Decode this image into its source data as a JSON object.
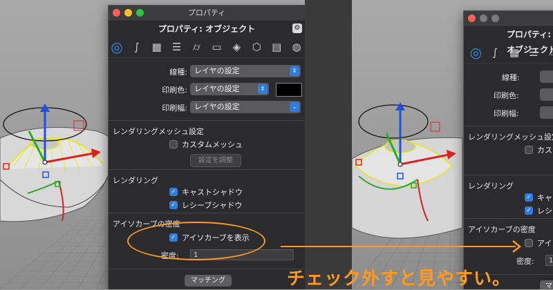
{
  "window": {
    "title": "プロパティ",
    "subtitle": "プロパティ: オブジェクト"
  },
  "toolbar": {
    "icons": [
      "object-props-icon",
      "curve-icon",
      "material-icon",
      "layers-icon",
      "cylinder-icon",
      "page-icon",
      "texture-icon",
      "box-icon",
      "surface-icon",
      "sphere-icon"
    ]
  },
  "props": {
    "linetype_label": "線種:",
    "linetype_value": "レイヤの設定",
    "print_color_label": "印刷色:",
    "print_color_value": "レイヤの設定",
    "print_color_swatch": "#000000",
    "print_width_label": "印刷幅:",
    "print_width_value": "レイヤの設定"
  },
  "render_mesh": {
    "heading": "レンダリングメッシュ設定",
    "custom_mesh_label": "カスタムメッシュ",
    "custom_mesh_checked": false,
    "adjust_button": "設定を調整"
  },
  "rendering": {
    "heading": "レンダリング",
    "cast_shadows_label": "キャストシャドウ",
    "cast_shadows_checked": true,
    "receive_shadows_label": "レシーブシャドウ",
    "receive_shadows_checked": true
  },
  "isocurve": {
    "heading": "アイソカーブの密度",
    "show_label": "アイソカーブを表示",
    "show_checked_before": true,
    "show_checked_after": false,
    "density_label": "密度:",
    "density_value": "1"
  },
  "matching_button": "マッチング",
  "right_panel": {
    "linetype_label": "線種:",
    "print_color_label": "印刷色:",
    "print_width_label": "印刷幅:",
    "mesh_heading_partial": "レンダリングメッシュ設定",
    "custom_mesh_partial": "カスタ",
    "rendering_heading": "レンダリング",
    "cast_partial": "キャス",
    "receive_partial": "レシー",
    "isocurve_heading": "アイソカーブの密度",
    "isocurve_partial": "アイソ",
    "density_label": "密度:",
    "density_partial": "1",
    "matching_partial": "マ"
  },
  "annotation": {
    "text": "チェック外すと見やすい。",
    "color": "#ff9a1f"
  },
  "colors": {
    "panel_bg": "#2b2b2d",
    "accent": "#2f7de0",
    "annotation": "#ff9a1f"
  }
}
